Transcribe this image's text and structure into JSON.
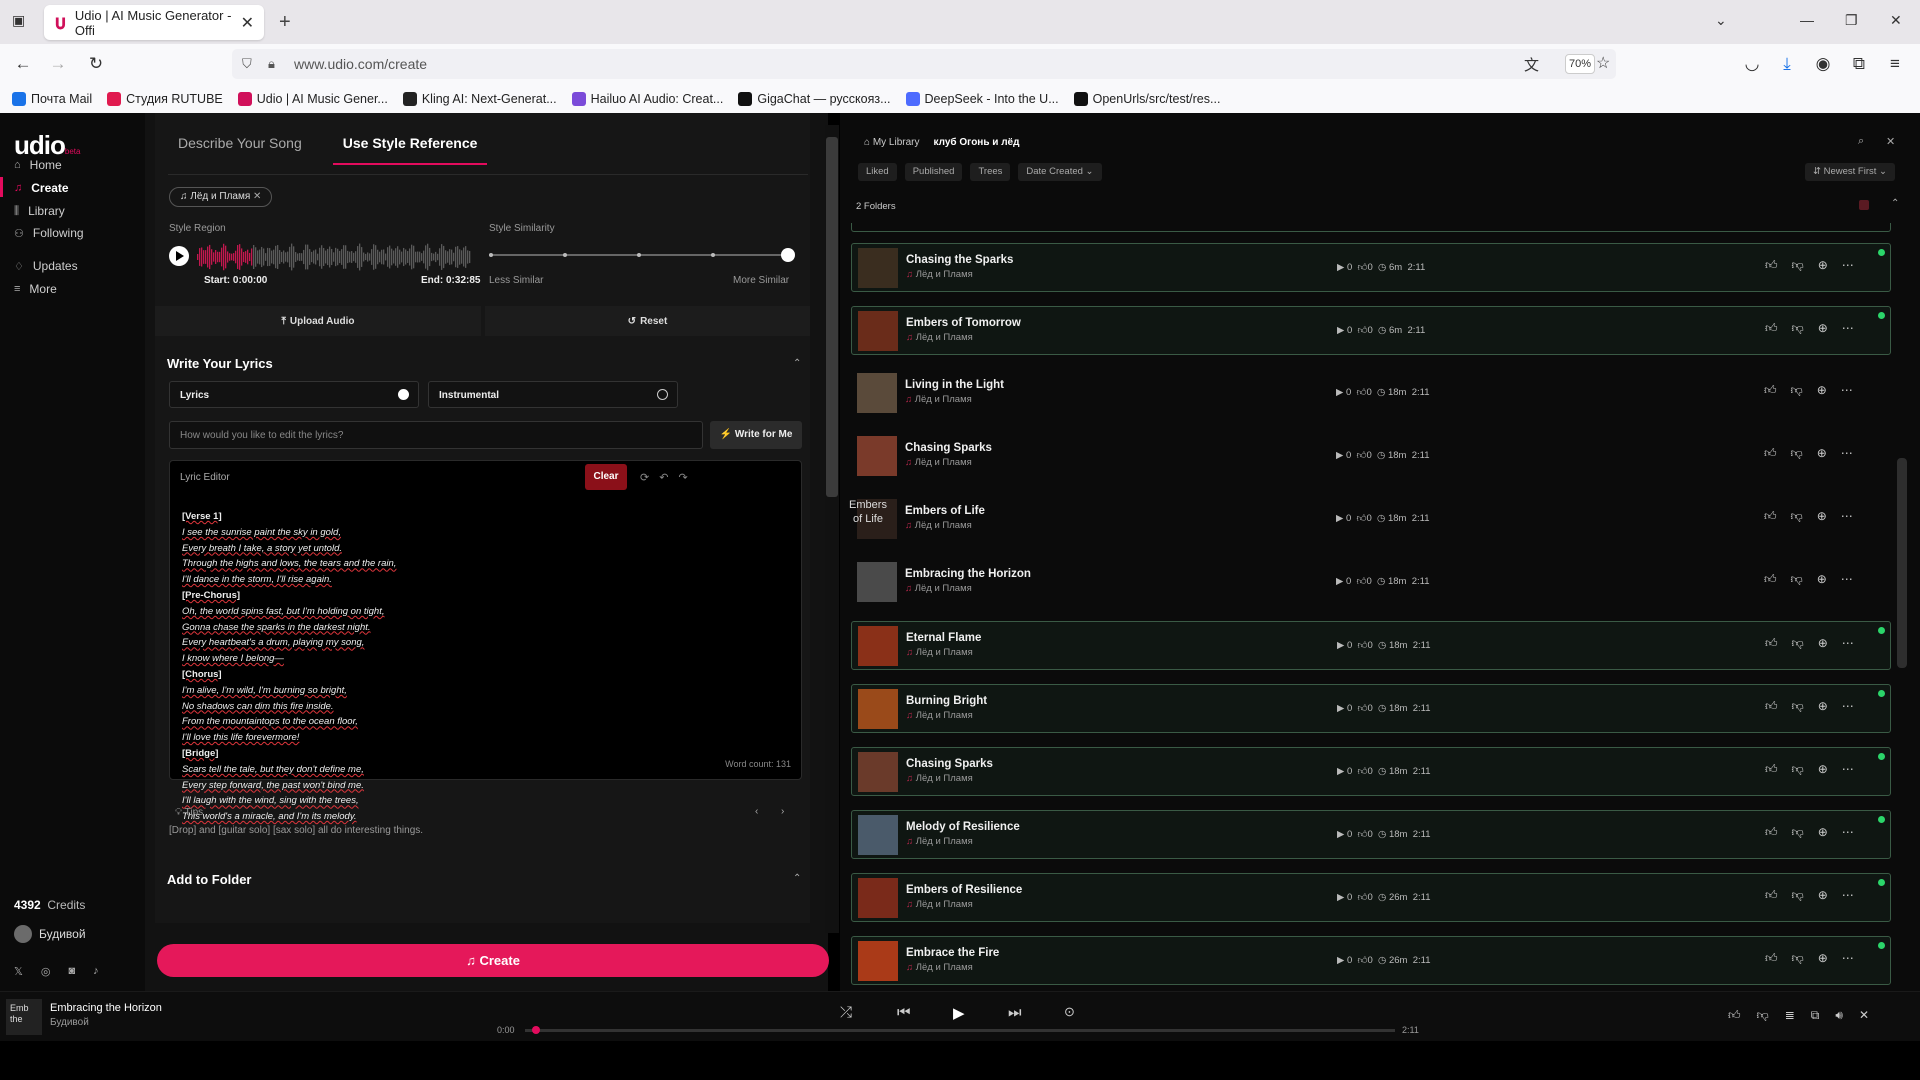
{
  "browser": {
    "tab_title": "Udio | AI Music Generator - Offi",
    "url": "www.udio.com/create",
    "zoom": "70%",
    "bookmarks": [
      {
        "label": "Почта Mail",
        "color": "#1a73e8"
      },
      {
        "label": "Студия RUTUBE",
        "color": "#e01a4f"
      },
      {
        "label": "Udio | AI Music Gener...",
        "color": "#d0105a"
      },
      {
        "label": "Kling AI: Next-Generat...",
        "color": "#222222"
      },
      {
        "label": "Hailuo AI Audio: Creat...",
        "color": "#7b4bd9"
      },
      {
        "label": "GigaChat — русскояз...",
        "color": "#111111"
      },
      {
        "label": "DeepSeek - Into the U...",
        "color": "#4d6bfe"
      },
      {
        "label": "OpenUrls/src/test/res...",
        "color": "#111111"
      }
    ]
  },
  "sidebar": {
    "logo": "udio",
    "logo_suffix": "beta",
    "items": [
      {
        "label": "Home",
        "icon": "home-icon"
      },
      {
        "label": "Create",
        "icon": "music-note-icon"
      },
      {
        "label": "Library",
        "icon": "library-icon"
      },
      {
        "label": "Following",
        "icon": "person-icon"
      },
      {
        "label": "Updates",
        "icon": "bell-icon"
      },
      {
        "label": "More",
        "icon": "menu-icon"
      }
    ],
    "credits_value": "4392",
    "credits_label": "Credits",
    "user": "Будивой"
  },
  "create": {
    "tabs": [
      "Describe Your Song",
      "Use Style Reference"
    ],
    "chip": "Лёд и Пламя",
    "style_region": "Style Region",
    "style_similarity": "Style Similarity",
    "start": "Start: 0:00:00",
    "end": "End: 0:32:85",
    "less_similar": "Less Similar",
    "more_similar": "More Similar",
    "upload": "Upload Audio",
    "reset": "Reset",
    "lyrics_section": "Write Your Lyrics",
    "opt_lyrics": "Lyrics",
    "opt_instrumental": "Instrumental",
    "edit_placeholder": "How would you like to edit the lyrics?",
    "write_for_me": "Write for Me",
    "lyric_editor": "Lyric Editor",
    "clear": "Clear",
    "lyrics": [
      {
        "t": "[Verse 1]",
        "h": true
      },
      {
        "t": "I see the sunrise paint the sky in gold,"
      },
      {
        "t": "Every breath I take, a story yet untold."
      },
      {
        "t": "Through the highs and lows, the tears and the rain,"
      },
      {
        "t": "I'll dance in the storm, I'll rise again."
      },
      {
        "t": "[Pre-Chorus]",
        "h": true
      },
      {
        "t": "Oh, the world spins fast, but I'm holding on tight,"
      },
      {
        "t": "Gonna chase the sparks in the darkest night."
      },
      {
        "t": "Every heartbeat's a drum, playing my song,"
      },
      {
        "t": "I know where I belong—"
      },
      {
        "t": "[Chorus]",
        "h": true
      },
      {
        "t": "I'm alive, I'm wild, I'm burning so bright,"
      },
      {
        "t": "No shadows can dim this fire inside."
      },
      {
        "t": "From the mountaintops to the ocean floor,"
      },
      {
        "t": "I'll love this life forevermore!"
      },
      {
        "t": "[Bridge]",
        "h": true
      },
      {
        "t": "Scars tell the tale, but they don't define me,"
      },
      {
        "t": "Every step forward, the past won't bind me."
      },
      {
        "t": "I'll laugh with the wind, sing with the trees,"
      },
      {
        "t": "This world's a miracle, and I'm its melody."
      }
    ],
    "word_count": "Word count: 131",
    "tips": "Tips",
    "tip_text": "[Drop] and [guitar solo] [sax solo] all do interesting things.",
    "add_folder": "Add to Folder",
    "create_btn": "Create"
  },
  "library": {
    "crumb1": "My Library",
    "crumb2": "клуб Огонь и лёд",
    "filters": [
      "Liked",
      "Published",
      "Trees",
      "Date Created"
    ],
    "sort": "Newest First",
    "folders": "2 Folders",
    "artist": "Лёд и Пламя",
    "songs": [
      {
        "title": "Chasing the Sparks",
        "plays": "0",
        "likes": "0",
        "age": "6m",
        "dur": "2:11",
        "boxed": true,
        "thumb": "#3a2d1f"
      },
      {
        "title": "Embers of Tomorrow",
        "plays": "0",
        "likes": "0",
        "age": "6m",
        "dur": "2:11",
        "boxed": true,
        "thumb": "#6a2c1a"
      },
      {
        "title": "Living in the Light",
        "plays": "0",
        "likes": "0",
        "age": "18m",
        "dur": "2:11",
        "boxed": false,
        "thumb": "#5a4a3a"
      },
      {
        "title": "Chasing Sparks",
        "plays": "0",
        "likes": "0",
        "age": "18m",
        "dur": "2:11",
        "boxed": false,
        "thumb": "#7a3a2a"
      },
      {
        "title": "Embers of Life",
        "plays": "0",
        "likes": "0",
        "age": "18m",
        "dur": "2:11",
        "boxed": false,
        "thumb": "#2a1f1a",
        "thumb_text": "Embers of Life"
      },
      {
        "title": "Embracing the Horizon",
        "plays": "0",
        "likes": "0",
        "age": "18m",
        "dur": "2:11",
        "boxed": false,
        "thumb": "#4a4a4a"
      },
      {
        "title": "Eternal Flame",
        "plays": "0",
        "likes": "0",
        "age": "18m",
        "dur": "2:11",
        "boxed": true,
        "thumb": "#8a3018"
      },
      {
        "title": "Burning Bright",
        "plays": "0",
        "likes": "0",
        "age": "18m",
        "dur": "2:11",
        "boxed": true,
        "thumb": "#9a4a1a"
      },
      {
        "title": "Chasing Sparks",
        "plays": "0",
        "likes": "0",
        "age": "18m",
        "dur": "2:11",
        "boxed": true,
        "thumb": "#6a3a2a"
      },
      {
        "title": "Melody of Resilience",
        "plays": "0",
        "likes": "0",
        "age": "18m",
        "dur": "2:11",
        "boxed": true,
        "thumb": "#4a5a6a"
      },
      {
        "title": "Embers of Resilience",
        "plays": "0",
        "likes": "0",
        "age": "26m",
        "dur": "2:11",
        "boxed": true,
        "thumb": "#7a2a1a"
      },
      {
        "title": "Embrace the Fire",
        "plays": "0",
        "likes": "0",
        "age": "26m",
        "dur": "2:11",
        "boxed": true,
        "thumb": "#aa3a18"
      }
    ]
  },
  "player": {
    "thumb_text": "Emb the",
    "title": "Embracing the Horizon",
    "artist": "Будивой",
    "current": "0:00",
    "total": "2:11",
    "progress": 0.008
  },
  "colors": {
    "accent": "#e30b5d",
    "online": "#2bd66a"
  }
}
